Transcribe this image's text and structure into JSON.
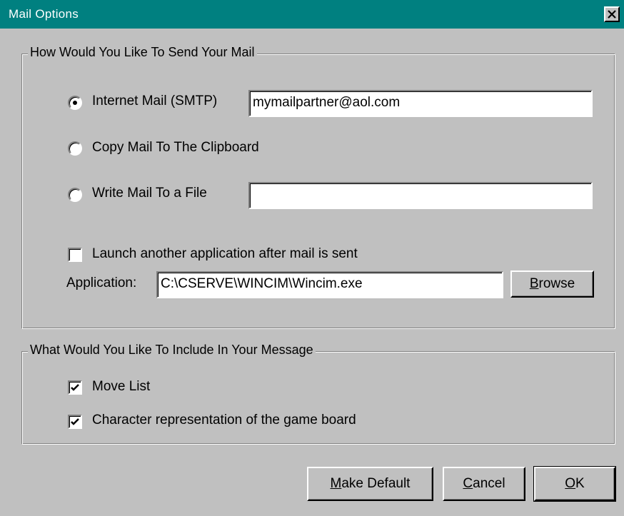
{
  "window": {
    "title": "Mail Options",
    "close_icon": "close-icon"
  },
  "send_group": {
    "legend": "How Would You Like To Send Your Mail",
    "options": [
      {
        "label": "Internet Mail (SMTP)",
        "selected": true,
        "field_value": "mymailpartner@aol.com"
      },
      {
        "label": "Copy Mail To The Clipboard",
        "selected": false
      },
      {
        "label": "Write Mail To a File",
        "selected": false,
        "field_value": ""
      }
    ],
    "launch_app": {
      "label": "Launch another application after mail is sent",
      "checked": false,
      "app_label": "Application:",
      "app_value": "C:\\CSERVE\\WINCIM\\Wincim.exe",
      "browse_label": "Browse"
    }
  },
  "include_group": {
    "legend": "What Would You Like To Include In Your Message",
    "items": [
      {
        "label": "Move List",
        "checked": true
      },
      {
        "label": "Character representation of the game board",
        "checked": true
      }
    ]
  },
  "buttons": {
    "make_default": "Make Default",
    "cancel": "Cancel",
    "ok": "OK"
  },
  "colors": {
    "titlebar": "#008080",
    "face": "#c0c0c0"
  }
}
